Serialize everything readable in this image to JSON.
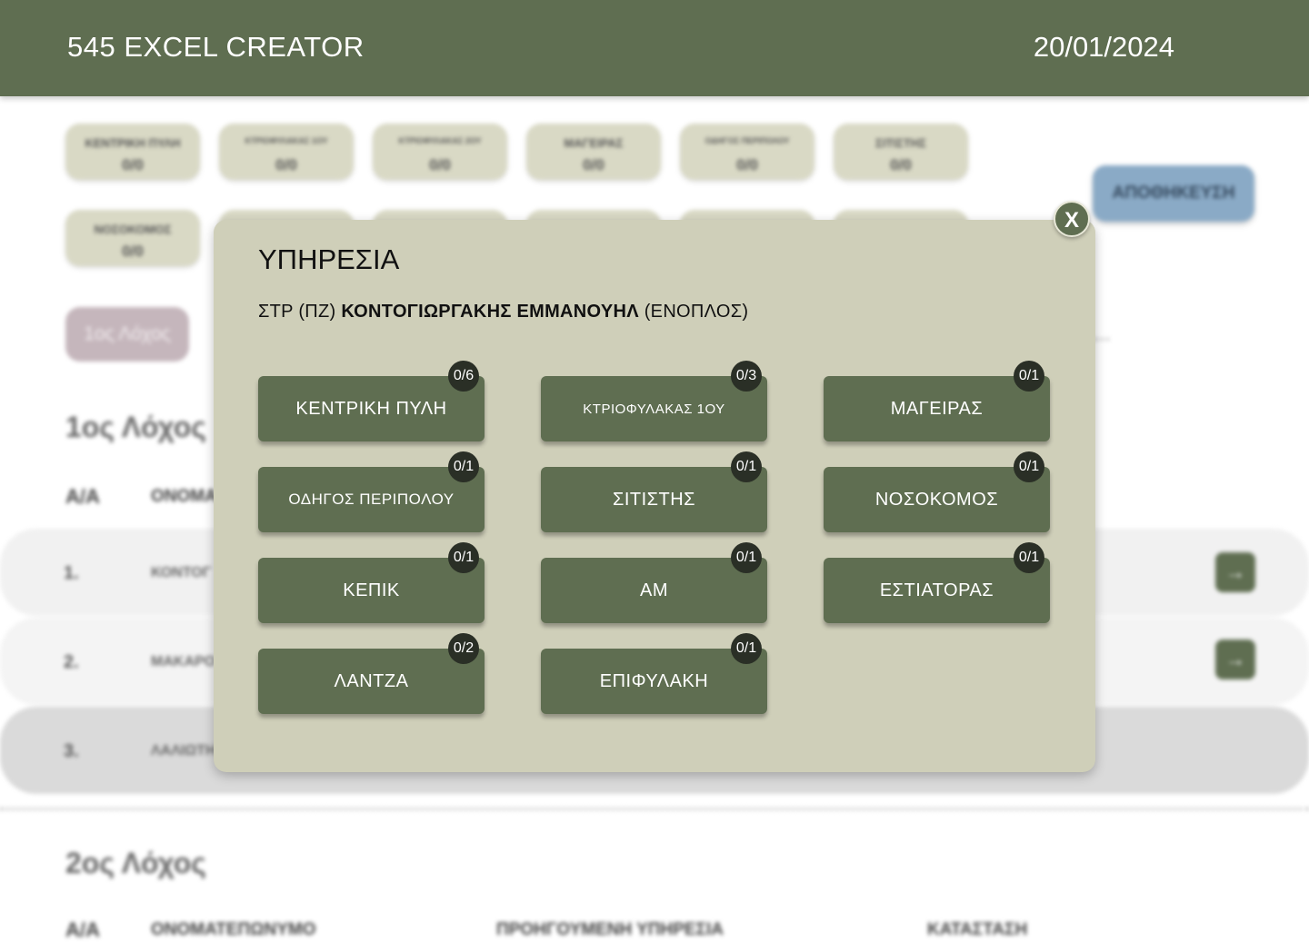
{
  "header": {
    "title": "545 EXCEL CREATOR",
    "date": "20/01/2024"
  },
  "summary_cards": [
    {
      "name": "ΚΕΝΤΡΙΚΗ ΠΥΛΗ",
      "count": "0/0"
    },
    {
      "name": "ΚΤΡΙΟΦΥΛΑΚΑΣ 1ΟΥ",
      "count": "0/0"
    },
    {
      "name": "ΚΤΡΙΟΦΥΛΑΚΑΣ 2ΟΥ",
      "count": "0/0"
    },
    {
      "name": "ΜΑΓΕΙΡΑΣ",
      "count": "0/0"
    },
    {
      "name": "ΟΔΗΓΟΣ ΠΕΡΙΠΟΛΟΥ",
      "count": "0/0"
    },
    {
      "name": "ΣΙΤΙΣΤΗΣ",
      "count": "0/0"
    },
    {
      "name": "ΝΟΣΟΚΟΜΟΣ",
      "count": "0/0"
    }
  ],
  "save_label": "ΑΠΟΘΗΚΕΥΣΗ",
  "company_tab": "1ος Λόχος",
  "section1": {
    "heading": "1ος Λόχος",
    "col_aa": "Α/Α",
    "col_name": "ΟΝΟΜΑ",
    "rows": [
      {
        "num": "1.",
        "name": "ΚΟΝΤΟΓ"
      },
      {
        "num": "2.",
        "name": "ΜΑΚΑΡΟ"
      },
      {
        "num": "3.",
        "name": "ΛΑΛΙΩΤΗ"
      }
    ]
  },
  "section2": {
    "heading": "2ος Λόχος",
    "col_aa": "Α/Α",
    "col_name": "ΟΝΟΜΑΤΕΠΩΝΥΜΟ",
    "col_prev": "ΠΡΟΗΓΟΥΜΕΝΗ ΥΠΗΡΕΣΙΑ",
    "col_status": "ΚΑΤΑΣΤΑΣΗ"
  },
  "modal": {
    "title": "ΥΠΗΡΕΣΙΑ",
    "person_prefix": "ΣΤΡ (ΠΖ)",
    "person_name": "ΚΟΝΤΟΓΙΩΡΓΑΚΗΣ ΕΜΜΑΝΟΥΗΛ",
    "person_suffix": "(ΕΝΟΠΛΟΣ)",
    "close_label": "X",
    "duties": [
      {
        "label": "ΚΕΝΤΡΙΚΗ ΠΥΛΗ",
        "count": "0/6"
      },
      {
        "label": "ΚΤΡΙΟΦΥΛΑΚΑΣ 1ΟΥ",
        "count": "0/3"
      },
      {
        "label": "ΜΑΓΕΙΡΑΣ",
        "count": "0/1"
      },
      {
        "label": "ΟΔΗΓΟΣ ΠΕΡΙΠΟΛΟΥ",
        "count": "0/1"
      },
      {
        "label": "ΣΙΤΙΣΤΗΣ",
        "count": "0/1"
      },
      {
        "label": "ΝΟΣΟΚΟΜΟΣ",
        "count": "0/1"
      },
      {
        "label": "ΚΕΠΙΚ",
        "count": "0/1"
      },
      {
        "label": "ΑΜ",
        "count": "0/1"
      },
      {
        "label": "ΕΣΤΙΑΤΟΡΑΣ",
        "count": "0/1"
      },
      {
        "label": "ΛΑΝΤΖΑ",
        "count": "0/2"
      },
      {
        "label": "ΕΠΙΦΥΛΑΚΗ",
        "count": "0/1"
      }
    ]
  },
  "icons": {
    "row_action": "arrow-right-icon",
    "close": "close-icon"
  },
  "colors": {
    "header": "#5f6e51",
    "modal_bg": "#cfcfb9",
    "button": "#5f6e51",
    "badge": "#2a2f26",
    "save": "#8aaac6"
  }
}
